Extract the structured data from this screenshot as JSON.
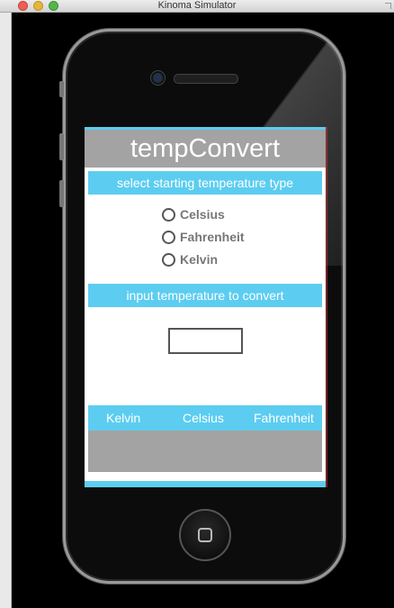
{
  "window": {
    "title": "Kinoma Simulator"
  },
  "app": {
    "title": "tempConvert",
    "select_prompt": "select starting temperature type",
    "radio_options": [
      "Celsius",
      "Fahrenheit",
      "Kelvin"
    ],
    "input_prompt": "input temperature to convert",
    "input_value": "",
    "unit_labels": [
      "Kelvin",
      "Celsius",
      "Fahrenheit"
    ]
  },
  "colors": {
    "accent": "#5ccdf0",
    "header_gray": "#a3a3a3",
    "label_gray": "#777777"
  },
  "icons": {
    "radio": "radio-circle-icon",
    "home": "home-square-icon"
  }
}
